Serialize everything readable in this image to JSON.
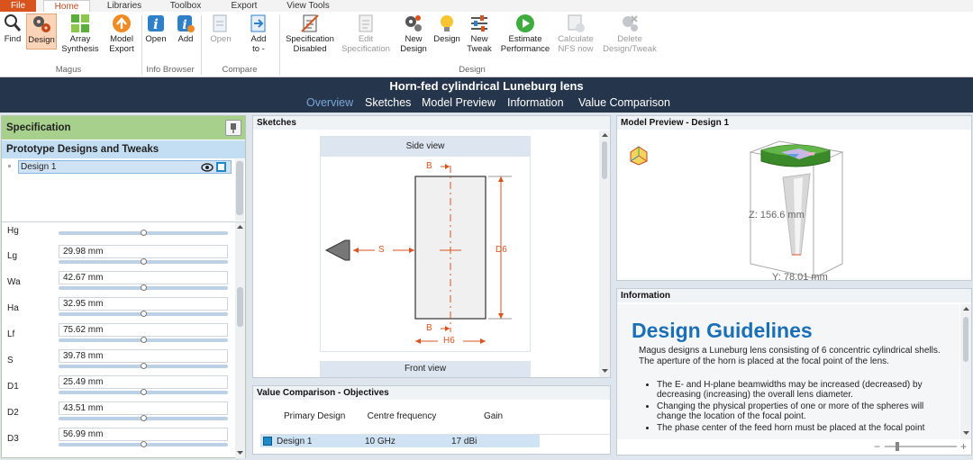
{
  "tabs": [
    {
      "label": "File"
    },
    {
      "label": "Home"
    },
    {
      "label": "Libraries"
    },
    {
      "label": "Toolbox"
    },
    {
      "label": "Export"
    },
    {
      "label": "View Tools"
    }
  ],
  "ribbon": {
    "find": "Find",
    "design": "Design",
    "array": "Array",
    "synthesis": "Synthesis",
    "model": "Model",
    "export": "Export",
    "open": "Open",
    "add": "Add",
    "open2": "Open",
    "add_to": "Add",
    "add_to2": "to -",
    "spec": "Specification",
    "spec2": "Disabled",
    "edit": "Edit",
    "edit2": "Specification",
    "new": "New",
    "new_design": "Design",
    "design2": "Design",
    "new2": "New",
    "tweak": "Tweak",
    "estimate": "Estimate",
    "performance": "Performance",
    "calculate": "Calculate",
    "nfs_now": "NFS now",
    "delete": "Delete",
    "design_tweak": "Design/Tweak",
    "groups": {
      "magus": "Magus",
      "info_browser": "Info Browser",
      "compare": "Compare",
      "design": "Design"
    }
  },
  "title": "Horn-fed cylindrical Luneburg lens",
  "nav": {
    "overview": "Overview",
    "sketches": "Sketches",
    "model_preview": "Model Preview",
    "information": "Information",
    "value_comparison": "Value Comparison"
  },
  "spec": {
    "title": "Specification",
    "prototypes_title": "Prototype Designs and Tweaks",
    "design_item": "Design 1",
    "hidden_param": "Hg",
    "params": [
      {
        "label": "Lg",
        "value": "29.98 mm"
      },
      {
        "label": "Wa",
        "value": "42.67 mm"
      },
      {
        "label": "Ha",
        "value": "32.95 mm"
      },
      {
        "label": "Lf",
        "value": "75.62 mm"
      },
      {
        "label": "S",
        "value": "39.78 mm"
      },
      {
        "label": "D1",
        "value": "25.49 mm"
      },
      {
        "label": "D2",
        "value": "43.51 mm"
      },
      {
        "label": "D3",
        "value": "56.99 mm"
      }
    ]
  },
  "sketches": {
    "title": "Sketches",
    "side_view": "Side view",
    "front_view": "Front view",
    "b": "B",
    "s": "S",
    "d6": "D6",
    "h6": "H6"
  },
  "model_preview": {
    "title": "Model Preview",
    "dash": "-",
    "design": "Design 1",
    "z_label": "Z: 156.6 mm",
    "y_label": "Y: 78.01 mm"
  },
  "information": {
    "title": "Information",
    "heading": "Design Guidelines",
    "intro": "Magus designs a Luneburg lens consisting of 6 concentric cylindrical shells. The aperture of the horn is placed at the focal point of the lens.",
    "bullets": [
      "The E- and H-plane beamwidths may be increased (decreased) by decreasing (increasing) the overall lens diameter.",
      "Changing the physical properties of one or more of the spheres will change the location of the focal point.",
      "The phase center of the feed horn must be placed at the focal point"
    ]
  },
  "value_comparison": {
    "title": "Value Comparison - Objectives",
    "columns": [
      "Primary Design",
      "Centre frequency",
      "Gain"
    ],
    "rows": [
      {
        "design": "Design 1",
        "freq": "10 GHz",
        "gain": "17 dBi"
      }
    ]
  },
  "colors": {
    "accent": "#d9531e",
    "nav_bg": "#25364c",
    "panel_header": "#a8d08d",
    "selection": "#cfe3f5",
    "heading_blue": "#1b6fb6"
  }
}
